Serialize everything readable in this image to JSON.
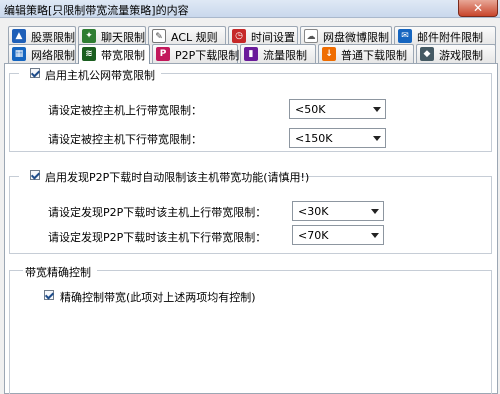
{
  "window": {
    "title": "编辑策略[只限制带宽流量策略]的内容",
    "close_label": "✕"
  },
  "tabs_row1": [
    {
      "label": "股票限制",
      "icon": "stock-icon",
      "color": "#1e5fb8"
    },
    {
      "label": "聊天限制",
      "icon": "chat-icon",
      "color": "#2e7d32"
    },
    {
      "label": "ACL 规则",
      "icon": "acl-icon",
      "color": "#555555"
    },
    {
      "label": "时间设置",
      "icon": "clock-icon",
      "color": "#c62828"
    },
    {
      "label": "网盘微博限制",
      "icon": "netdisk-icon",
      "color": "#7b7b7b"
    },
    {
      "label": "邮件附件限制",
      "icon": "mail-icon",
      "color": "#1565c0"
    }
  ],
  "tabs_row2": [
    {
      "label": "网络限制",
      "icon": "network-icon",
      "color": "#1565c0"
    },
    {
      "label": "带宽限制",
      "icon": "bandwidth-icon",
      "color": "#2e7d32",
      "active": true
    },
    {
      "label": "P2P下载限制",
      "icon": "p2p-icon",
      "color": "#c2185b"
    },
    {
      "label": "流量限制",
      "icon": "traffic-icon",
      "color": "#6a1b9a"
    },
    {
      "label": "普通下载限制",
      "icon": "download-icon",
      "color": "#ef6c00"
    },
    {
      "label": "游戏限制",
      "icon": "game-icon",
      "color": "#455a64"
    }
  ],
  "bandwidth_group": {
    "label": "启用主机公网带宽限制",
    "checked": true,
    "upload_label": "请设定被控主机上行带宽限制：",
    "upload_value": "<50K",
    "download_label": "请设定被控主机下行带宽限制：",
    "download_value": "<150K"
  },
  "p2p_group": {
    "label": "启用发现P2P下载时自动限制该主机带宽功能(请慎用!)",
    "checked": true,
    "upload_label": "请设定发现P2P下载时该主机上行带宽限制：",
    "upload_value": "<30K",
    "download_label": "请设定发现P2P下载时该主机下行带宽限制：",
    "download_value": "<70K"
  },
  "precise_group": {
    "title": "带宽精确控制",
    "label": "精确控制带宽(此项对上述两项均有控制)",
    "checked": true
  }
}
